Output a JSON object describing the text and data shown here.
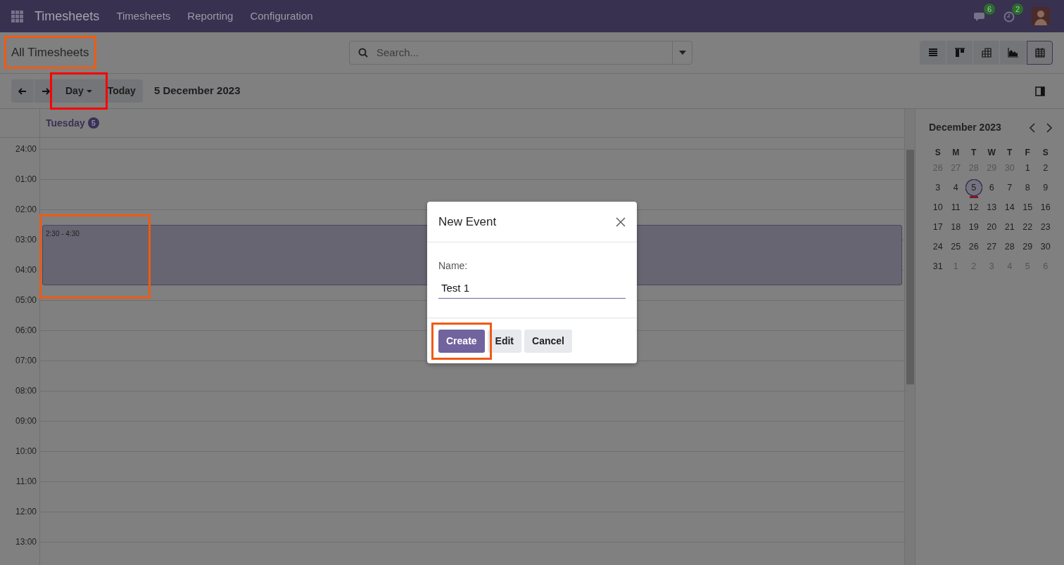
{
  "navbar": {
    "app_name": "Timesheets",
    "menu": [
      "Timesheets",
      "Reporting",
      "Configuration"
    ],
    "messages_badge": "6",
    "activities_badge": "2"
  },
  "control_panel": {
    "title": "All Timesheets",
    "title_highlight": {
      "color": "#f05a12"
    },
    "search": {
      "placeholder": "Search..."
    },
    "views": [
      {
        "kind": "list",
        "selected": false
      },
      {
        "kind": "kanban",
        "selected": false
      },
      {
        "kind": "pivot",
        "selected": false
      },
      {
        "kind": "graph",
        "selected": false
      },
      {
        "kind": "calendar",
        "selected": true
      }
    ]
  },
  "toolbar": {
    "period": "Day",
    "period_highlight": {
      "color": "#ff0000"
    },
    "today": "Today",
    "date": "5 December 2023"
  },
  "day_header": {
    "weekday": "Tuesday",
    "day": "5"
  },
  "hours": [
    "24:00",
    "01:00",
    "02:00",
    "03:00",
    "04:00",
    "05:00",
    "06:00",
    "07:00",
    "08:00",
    "09:00",
    "10:00",
    "11:00",
    "12:00",
    "13:00"
  ],
  "events": [
    {
      "time": "2:30 - 4:30",
      "highlight": {
        "color": "#f05a12"
      }
    }
  ],
  "mini_calendar": {
    "title": "December 2023",
    "weekdays": [
      "S",
      "M",
      "T",
      "W",
      "T",
      "F",
      "S"
    ],
    "weeks": [
      [
        {
          "label": "26",
          "muted": true,
          "selected": false,
          "today": false
        },
        {
          "label": "27",
          "muted": true,
          "selected": false,
          "today": false
        },
        {
          "label": "28",
          "muted": true,
          "selected": false,
          "today": false
        },
        {
          "label": "29",
          "muted": true,
          "selected": false,
          "today": false
        },
        {
          "label": "30",
          "muted": true,
          "selected": false,
          "today": false
        },
        {
          "label": "1",
          "muted": false,
          "selected": false,
          "today": false
        },
        {
          "label": "2",
          "muted": false,
          "selected": false,
          "today": false
        }
      ],
      [
        {
          "label": "3",
          "muted": false,
          "selected": false,
          "today": false
        },
        {
          "label": "4",
          "muted": false,
          "selected": false,
          "today": false
        },
        {
          "label": "5",
          "muted": false,
          "selected": true,
          "today": true
        },
        {
          "label": "6",
          "muted": false,
          "selected": false,
          "today": false
        },
        {
          "label": "7",
          "muted": false,
          "selected": false,
          "today": false
        },
        {
          "label": "8",
          "muted": false,
          "selected": false,
          "today": false
        },
        {
          "label": "9",
          "muted": false,
          "selected": false,
          "today": false
        }
      ],
      [
        {
          "label": "10",
          "muted": false,
          "selected": false,
          "today": false
        },
        {
          "label": "11",
          "muted": false,
          "selected": false,
          "today": false
        },
        {
          "label": "12",
          "muted": false,
          "selected": false,
          "today": false
        },
        {
          "label": "13",
          "muted": false,
          "selected": false,
          "today": false
        },
        {
          "label": "14",
          "muted": false,
          "selected": false,
          "today": false
        },
        {
          "label": "15",
          "muted": false,
          "selected": false,
          "today": false
        },
        {
          "label": "16",
          "muted": false,
          "selected": false,
          "today": false
        }
      ],
      [
        {
          "label": "17",
          "muted": false,
          "selected": false,
          "today": false
        },
        {
          "label": "18",
          "muted": false,
          "selected": false,
          "today": false
        },
        {
          "label": "19",
          "muted": false,
          "selected": false,
          "today": false
        },
        {
          "label": "20",
          "muted": false,
          "selected": false,
          "today": false
        },
        {
          "label": "21",
          "muted": false,
          "selected": false,
          "today": false
        },
        {
          "label": "22",
          "muted": false,
          "selected": false,
          "today": false
        },
        {
          "label": "23",
          "muted": false,
          "selected": false,
          "today": false
        }
      ],
      [
        {
          "label": "24",
          "muted": false,
          "selected": false,
          "today": false
        },
        {
          "label": "25",
          "muted": false,
          "selected": false,
          "today": false
        },
        {
          "label": "26",
          "muted": false,
          "selected": false,
          "today": false
        },
        {
          "label": "27",
          "muted": false,
          "selected": false,
          "today": false
        },
        {
          "label": "28",
          "muted": false,
          "selected": false,
          "today": false
        },
        {
          "label": "29",
          "muted": false,
          "selected": false,
          "today": false
        },
        {
          "label": "30",
          "muted": false,
          "selected": false,
          "today": false
        }
      ],
      [
        {
          "label": "31",
          "muted": false,
          "selected": false,
          "today": false
        },
        {
          "label": "1",
          "muted": true,
          "selected": false,
          "today": false
        },
        {
          "label": "2",
          "muted": true,
          "selected": false,
          "today": false
        },
        {
          "label": "3",
          "muted": true,
          "selected": false,
          "today": false
        },
        {
          "label": "4",
          "muted": true,
          "selected": false,
          "today": false
        },
        {
          "label": "5",
          "muted": true,
          "selected": false,
          "today": false
        },
        {
          "label": "6",
          "muted": true,
          "selected": false,
          "today": false
        }
      ]
    ]
  },
  "dialog": {
    "title": "New Event",
    "field_label": "Name:",
    "value": "Test 1",
    "buttons": [
      {
        "label": "Create",
        "kind": "primary",
        "highlight": {
          "color": "#f05a12"
        }
      },
      {
        "label": "Edit",
        "kind": "secondary"
      },
      {
        "label": "Cancel",
        "kind": "secondary"
      }
    ]
  }
}
